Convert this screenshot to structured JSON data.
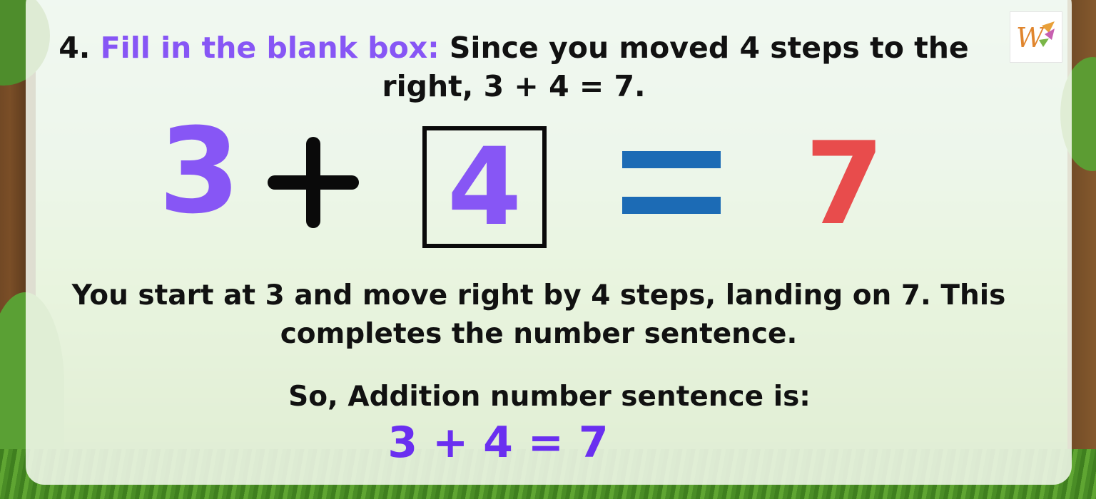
{
  "heading": {
    "number": "4.",
    "highlight": "Fill in the blank box:",
    "text": "Since you moved 4 steps to the right, 3 + 4 = 7."
  },
  "equation": {
    "first": "3",
    "blank_answer": "4",
    "result": "7"
  },
  "explanation": "You start at 3 and move right by 4 steps, landing on 7. This completes the number sentence.",
  "summary_label": "So, Addition number sentence is:",
  "summary_sentence": "3 + 4 = 7",
  "colors": {
    "purple": "#8756f5",
    "blue": "#1c6bb5",
    "red": "#e84c4c",
    "answer_purple": "#6a2ff0"
  },
  "logo_icon": "w-brand-logo-icon"
}
